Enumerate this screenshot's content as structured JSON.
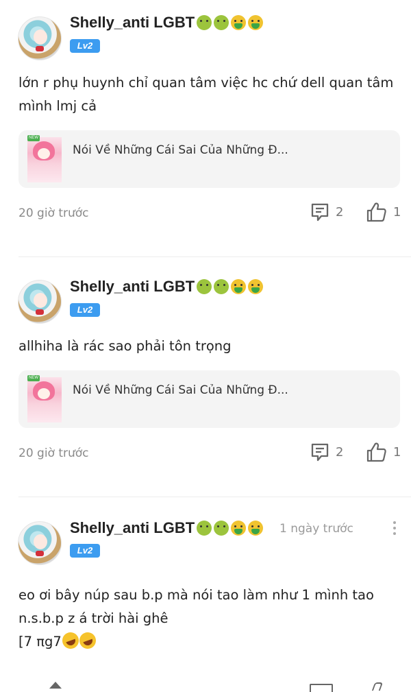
{
  "comments": [
    {
      "username": "Shelly_anti LGBT",
      "level": "Lv2",
      "content": "lớn r phụ huynh chỉ quan tâm việc hc chứ dell quan tâm mình lmj cả",
      "post_title": "Nói Về Những Cái Sai Của Những Đ...",
      "post_tag": "NEW",
      "time": "20 giờ trước",
      "reply_count": "2",
      "like_count": "1"
    },
    {
      "username": "Shelly_anti LGBT",
      "level": "Lv2",
      "content": "allhiha là rác sao phải tôn trọng",
      "post_title": "Nói Về Những Cái Sai Của Những Đ...",
      "post_tag": "NEW",
      "time": "20 giờ trước",
      "reply_count": "2",
      "like_count": "1"
    },
    {
      "username": "Shelly_anti LGBT",
      "level": "Lv2",
      "header_time": "1 ngày trước",
      "content_line1": "eo ơi bây núp sau b.p mà nói tao làm như 1 mình tao n.s.b.p z á trời hài ghê",
      "content_line2": "[7 πg7"
    }
  ],
  "icons": {
    "reply": "comment-icon",
    "like": "thumbs-up-icon",
    "more": "more-vertical-icon",
    "emoji_sick": "nauseated-face-icon",
    "emoji_vomit": "vomiting-face-icon",
    "emoji_laugh": "rolling-laughing-icon"
  },
  "colors": {
    "level_badge": "#3c9cf0",
    "card_bg": "#f4f4f4",
    "meta_text": "#8a8a8a"
  }
}
